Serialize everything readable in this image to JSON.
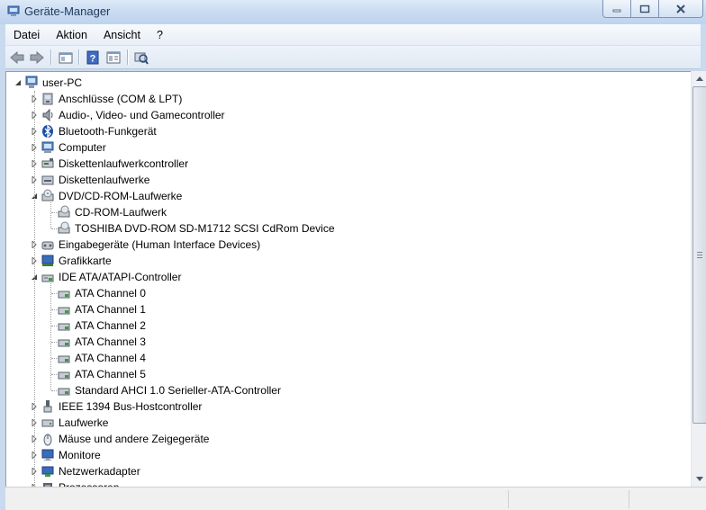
{
  "window": {
    "title": "Geräte-Manager",
    "minimize_glyph": "▭",
    "maximize_glyph": "▢",
    "close_glyph": "✕"
  },
  "menu": [
    "Datei",
    "Aktion",
    "Ansicht",
    "?"
  ],
  "toolbar": {
    "buttons": [
      "back-arrow-icon",
      "forward-arrow-icon",
      "show-hide-tree-icon",
      "help-icon",
      "properties-icon",
      "scan-hardware-icon"
    ]
  },
  "tree": {
    "root": "user-PC",
    "items": [
      {
        "label": "Anschlüsse (COM & LPT)",
        "icon": "port-icon",
        "expanded": false
      },
      {
        "label": "Audio-, Video- und Gamecontroller",
        "icon": "speaker-icon",
        "expanded": false
      },
      {
        "label": "Bluetooth-Funkgerät",
        "icon": "bluetooth-icon",
        "expanded": false
      },
      {
        "label": "Computer",
        "icon": "computer-icon",
        "expanded": false
      },
      {
        "label": "Diskettenlaufwerkcontroller",
        "icon": "floppy-controller-icon",
        "expanded": false
      },
      {
        "label": "Diskettenlaufwerke",
        "icon": "floppy-drive-icon",
        "expanded": false
      },
      {
        "label": "DVD/CD-ROM-Laufwerke",
        "icon": "optical-drive-icon",
        "expanded": true,
        "children": [
          "CD-ROM-Laufwerk",
          "TOSHIBA DVD-ROM SD-M1712 SCSI CdRom Device"
        ]
      },
      {
        "label": "Eingabegeräte (Human Interface Devices)",
        "icon": "hid-icon",
        "expanded": false
      },
      {
        "label": "Grafikkarte",
        "icon": "display-adapter-icon",
        "expanded": false
      },
      {
        "label": "IDE ATA/ATAPI-Controller",
        "icon": "ide-controller-icon",
        "expanded": true,
        "children": [
          "ATA Channel 0",
          "ATA Channel 1",
          "ATA Channel 2",
          "ATA Channel 3",
          "ATA Channel 4",
          "ATA Channel 5",
          "Standard AHCI 1.0 Serieller-ATA-Controller"
        ]
      },
      {
        "label": "IEEE 1394 Bus-Hostcontroller",
        "icon": "firewire-icon",
        "expanded": false
      },
      {
        "label": "Laufwerke",
        "icon": "disk-drive-icon",
        "expanded": false
      },
      {
        "label": "Mäuse und andere Zeigegeräte",
        "icon": "mouse-icon",
        "expanded": false
      },
      {
        "label": "Monitore",
        "icon": "monitor-icon",
        "expanded": false
      },
      {
        "label": "Netzwerkadapter",
        "icon": "network-adapter-icon",
        "expanded": false
      },
      {
        "label": "Prozessoren",
        "icon": "processor-icon",
        "expanded": false
      }
    ]
  },
  "colors": {
    "title_text": "#1e395b",
    "frame": "#c9d9ee"
  }
}
